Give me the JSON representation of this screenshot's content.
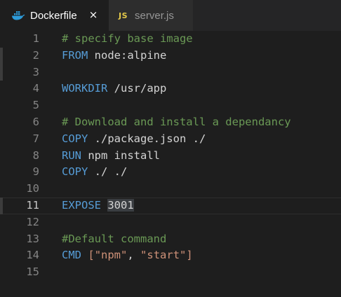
{
  "tabs": [
    {
      "label": "Dockerfile",
      "icon": "docker-icon",
      "active": true,
      "close_glyph": "×"
    },
    {
      "label": "server.js",
      "icon_text": "JS",
      "active": false
    }
  ],
  "code": {
    "current_line": 11,
    "lines": [
      {
        "n": "1",
        "tokens": [
          {
            "t": "# specify base image",
            "c": "cm"
          }
        ]
      },
      {
        "n": "2",
        "tokens": [
          {
            "t": "FROM",
            "c": "kw"
          },
          {
            "t": " node:alpine",
            "c": "pl"
          }
        ]
      },
      {
        "n": "3",
        "tokens": []
      },
      {
        "n": "4",
        "tokens": [
          {
            "t": "WORKDIR",
            "c": "kw"
          },
          {
            "t": " /usr/app",
            "c": "pl"
          }
        ]
      },
      {
        "n": "5",
        "tokens": []
      },
      {
        "n": "6",
        "tokens": [
          {
            "t": "# Download and install a dependancy",
            "c": "cm"
          }
        ]
      },
      {
        "n": "7",
        "tokens": [
          {
            "t": "COPY",
            "c": "kw"
          },
          {
            "t": " ./package.json ./",
            "c": "pl"
          }
        ]
      },
      {
        "n": "8",
        "tokens": [
          {
            "t": "RUN",
            "c": "kw"
          },
          {
            "t": " npm install",
            "c": "pl"
          }
        ]
      },
      {
        "n": "9",
        "tokens": [
          {
            "t": "COPY",
            "c": "kw"
          },
          {
            "t": " ./ ./",
            "c": "pl"
          }
        ]
      },
      {
        "n": "10",
        "tokens": []
      },
      {
        "n": "11",
        "tokens": [
          {
            "t": "EXPOSE",
            "c": "kw"
          },
          {
            "t": " ",
            "c": "pl"
          },
          {
            "t": "3001",
            "c": "pl",
            "sel": true
          }
        ]
      },
      {
        "n": "12",
        "tokens": []
      },
      {
        "n": "13",
        "tokens": [
          {
            "t": "#Default command",
            "c": "cm"
          }
        ]
      },
      {
        "n": "14",
        "tokens": [
          {
            "t": "CMD",
            "c": "kw"
          },
          {
            "t": " ",
            "c": "pl"
          },
          {
            "t": "[",
            "c": "str"
          },
          {
            "t": "\"npm\"",
            "c": "str"
          },
          {
            "t": ", ",
            "c": "pl"
          },
          {
            "t": "\"start\"",
            "c": "str"
          },
          {
            "t": "]",
            "c": "str"
          }
        ]
      },
      {
        "n": "15",
        "tokens": []
      }
    ]
  },
  "colors": {
    "keyword": "#569cd6",
    "comment": "#6a9955",
    "string": "#ce9178",
    "plain": "#d4d4d4",
    "line_number": "#858585",
    "background": "#1e1e1e",
    "js_badge": "#e3c94a",
    "docker_icon": "#2d9bd9"
  }
}
